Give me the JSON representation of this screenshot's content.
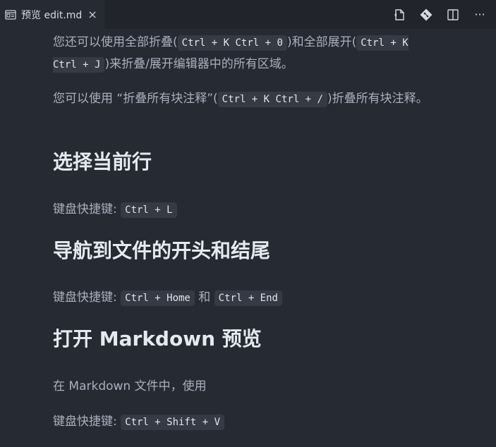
{
  "tab": {
    "title": "预览 edit.md",
    "close": "×"
  },
  "toolbar": {
    "icons": [
      "open-source-icon",
      "git-icon",
      "split-editor-icon",
      "more-icon"
    ],
    "more": "···"
  },
  "paragraphs": {
    "p1_a": "您还可以使用全部折叠(",
    "p1_code1": "Ctrl + K Ctrl + 0",
    "p1_b": ")和全部展开(",
    "p1_code2": "Ctrl + K Ctrl + J",
    "p1_c": ")来折叠/展开编辑器中的所有区域。",
    "p2_a": "您可以使用 “折叠所有块注释”(",
    "p2_code": "Ctrl + K Ctrl + /",
    "p2_b": ")折叠所有块注释。",
    "h_select_line": "选择当前行",
    "p3_label": "键盘快捷键:",
    "p3_code": "Ctrl + L",
    "h_navigate": "导航到文件的开头和结尾",
    "p4_label": "键盘快捷键:",
    "p4_code1": "Ctrl + Home",
    "p4_and": "和",
    "p4_code2": "Ctrl + End",
    "h_preview": "打开 Markdown 预览",
    "p5": "在 Markdown 文件中，使用",
    "p6_label": "键盘快捷键:",
    "p6_code": "Ctrl + Shift + V"
  }
}
